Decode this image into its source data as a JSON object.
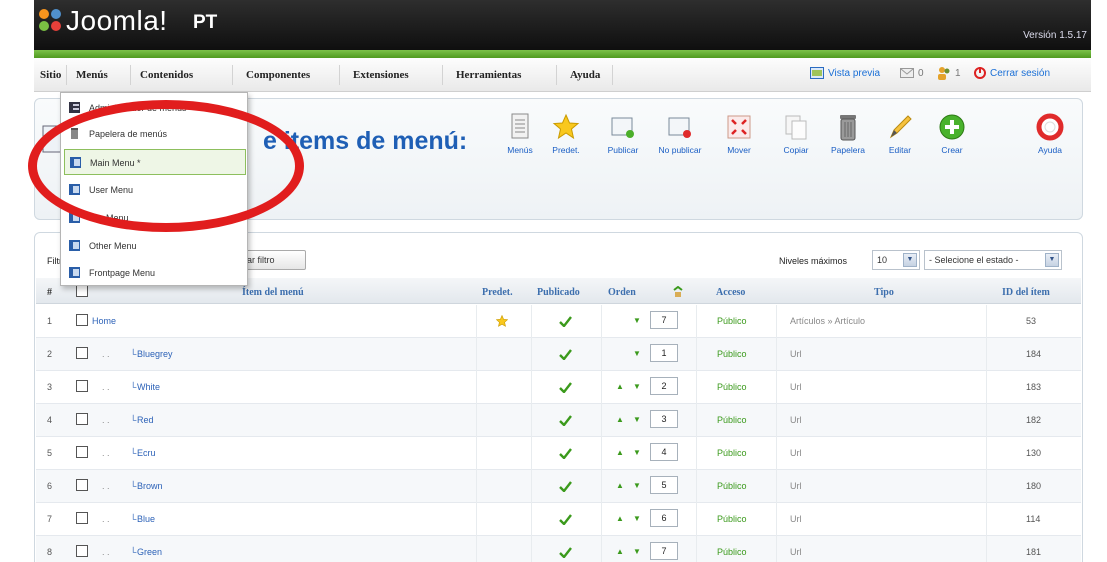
{
  "header": {
    "logo_text": "Joomla!",
    "logo_suffix": "PT",
    "version": "Versión 1.5.17",
    "colors": {
      "bar": "#1a1a1a",
      "accent_green": "#5faf28"
    }
  },
  "menubar": {
    "items": [
      {
        "label": "Sitio"
      },
      {
        "label": "Menús"
      },
      {
        "label": "Contenidos"
      },
      {
        "label": "Componentes"
      },
      {
        "label": "Extensiones"
      },
      {
        "label": "Herramientas"
      },
      {
        "label": "Ayuda"
      }
    ],
    "status": {
      "preview": "Vista previa",
      "messages_count": "0",
      "users_count": "1",
      "logout": "Cerrar sesión"
    }
  },
  "dropdown": {
    "items": [
      {
        "label": "Administrador de menús",
        "icon": "menu-manager-icon"
      },
      {
        "label": "Papelera de menús",
        "icon": "trash-icon"
      },
      {
        "label": "Main Menu *",
        "icon": "menu-icon",
        "active": true
      },
      {
        "label": "User Menu",
        "icon": "menu-icon"
      },
      {
        "label": "Top Menu",
        "icon": "menu-icon"
      },
      {
        "label": "Other Menu",
        "icon": "menu-icon"
      },
      {
        "label": "Frontpage Menu",
        "icon": "menu-icon"
      }
    ]
  },
  "toolbar": {
    "title": "e items de menú:",
    "buttons": [
      {
        "label": "Menús",
        "icon": "menus-icon"
      },
      {
        "label": "Predet.",
        "icon": "star-icon"
      },
      {
        "label": "Publicar",
        "icon": "publish-icon"
      },
      {
        "label": "No publicar",
        "icon": "unpublish-icon"
      },
      {
        "label": "Mover",
        "icon": "move-icon"
      },
      {
        "label": "Copiar",
        "icon": "copy-icon"
      },
      {
        "label": "Papelera",
        "icon": "trash-can-icon"
      },
      {
        "label": "Editar",
        "icon": "edit-icon"
      },
      {
        "label": "Crear",
        "icon": "add-icon"
      },
      {
        "label": "Ayuda",
        "icon": "help-icon"
      }
    ]
  },
  "filters": {
    "filter_label": "Filtro:",
    "clear_button": "iar filtro",
    "levels_label": "Niveles máximos",
    "levels_value": "10",
    "state_select": "- Selecione el estado -"
  },
  "table": {
    "headers": {
      "num": "#",
      "item": "Ítem del menú",
      "default": "Predet.",
      "published": "Publicado",
      "order": "Orden",
      "access": "Acceso",
      "type": "Tipo",
      "id": "ID del ítem"
    },
    "rows": [
      {
        "num": "1",
        "name": "Home",
        "is_child": false,
        "default": true,
        "order": "7",
        "up": false,
        "down": true,
        "access": "Público",
        "type": "Artículos » Artículo",
        "id": "53"
      },
      {
        "num": "2",
        "name": "Bluegrey",
        "is_child": true,
        "default": false,
        "order": "1",
        "up": false,
        "down": true,
        "access": "Público",
        "type": "Url",
        "id": "184"
      },
      {
        "num": "3",
        "name": "White",
        "is_child": true,
        "default": false,
        "order": "2",
        "up": true,
        "down": true,
        "access": "Público",
        "type": "Url",
        "id": "183"
      },
      {
        "num": "4",
        "name": "Red",
        "is_child": true,
        "default": false,
        "order": "3",
        "up": true,
        "down": true,
        "access": "Público",
        "type": "Url",
        "id": "182"
      },
      {
        "num": "5",
        "name": "Ecru",
        "is_child": true,
        "default": false,
        "order": "4",
        "up": true,
        "down": true,
        "access": "Público",
        "type": "Url",
        "id": "130"
      },
      {
        "num": "6",
        "name": "Brown",
        "is_child": true,
        "default": false,
        "order": "5",
        "up": true,
        "down": true,
        "access": "Público",
        "type": "Url",
        "id": "180"
      },
      {
        "num": "7",
        "name": "Blue",
        "is_child": true,
        "default": false,
        "order": "6",
        "up": true,
        "down": true,
        "access": "Público",
        "type": "Url",
        "id": "114"
      },
      {
        "num": "8",
        "name": "Green",
        "is_child": true,
        "default": false,
        "order": "7",
        "up": true,
        "down": true,
        "access": "Público",
        "type": "Url",
        "id": "181"
      }
    ]
  }
}
